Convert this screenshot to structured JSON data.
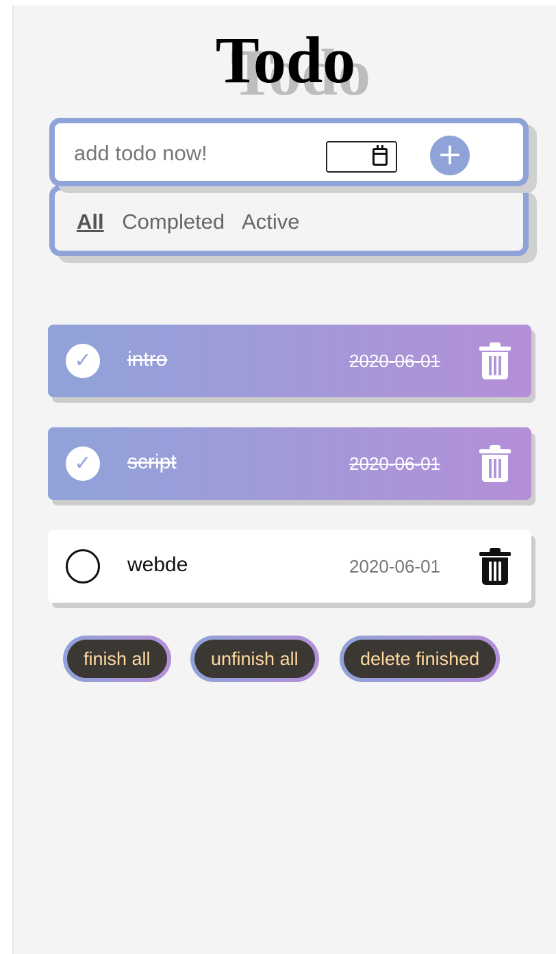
{
  "header": {
    "title": "Todo"
  },
  "add": {
    "placeholder": "add todo now!",
    "add_label": "+"
  },
  "filters": {
    "all": "All",
    "completed": "Completed",
    "active": "Active"
  },
  "todos": [
    {
      "name": "intro",
      "date": "2020-06-01",
      "completed": true
    },
    {
      "name": "script",
      "date": "2020-06-01",
      "completed": true
    },
    {
      "name": "webde",
      "date": "2020-06-01",
      "completed": false
    }
  ],
  "actions": {
    "finish_all": "finish all",
    "unfinish_all": "unfinish all",
    "delete_finished": "delete finished"
  },
  "colors": {
    "accent": "#8fa3d9",
    "gradient_end": "#b48fd8",
    "button_bg": "#3b3834",
    "button_text": "#ffd9a0"
  }
}
